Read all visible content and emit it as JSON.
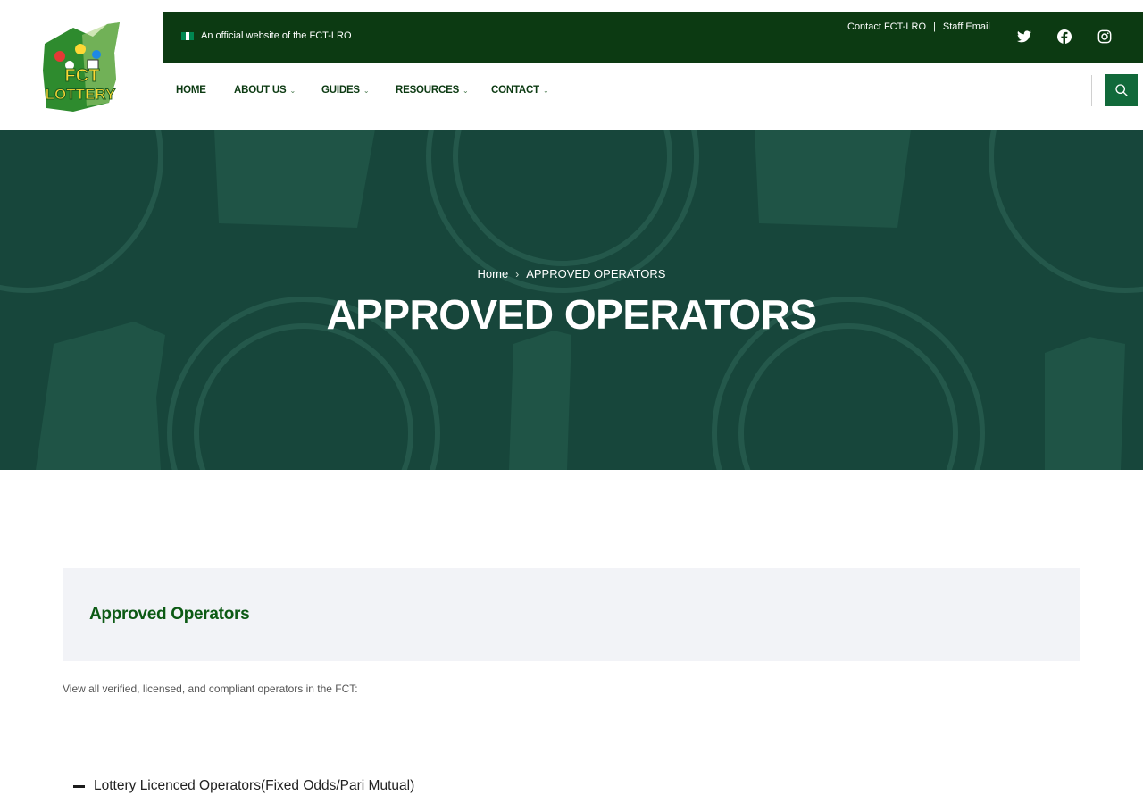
{
  "header": {
    "official_text": "An official website of the FCT-LRO",
    "contact_link": "Contact FCT-LRO",
    "separator": "|",
    "staff_email_link": "Staff Email",
    "logo_text_top": "FCT",
    "logo_text_bottom": "LOTTERY",
    "flag_colors": [
      "#008751",
      "#ffffff",
      "#008751"
    ]
  },
  "social": {
    "icons": [
      "twitter-icon",
      "facebook-icon",
      "instagram-icon"
    ]
  },
  "nav": {
    "items": [
      {
        "label": "HOME",
        "has_dropdown": false
      },
      {
        "label": "ABOUT US",
        "has_dropdown": true
      },
      {
        "label": "GUIDES",
        "has_dropdown": true
      },
      {
        "label": "RESOURCES",
        "has_dropdown": true
      },
      {
        "label": "CONTACT",
        "has_dropdown": true
      }
    ],
    "search_icon": "search-icon"
  },
  "hero": {
    "breadcrumb_home": "Home",
    "breadcrumb_current": "APPROVED OPERATORS",
    "title": "APPROVED OPERATORS"
  },
  "content": {
    "panel_title": "Approved Operators",
    "intro": "View all verified, licensed, and compliant operators in the FCT:",
    "accordion_label": "Lottery Licenced Operators(Fixed Odds/Pari Mutual)"
  },
  "colors": {
    "dark_green": "#0c3a12",
    "accent_green": "#11693a",
    "hero_bg": "#17463b",
    "panel_bg": "#f2f3f7",
    "heading_green": "#0c5a14"
  }
}
